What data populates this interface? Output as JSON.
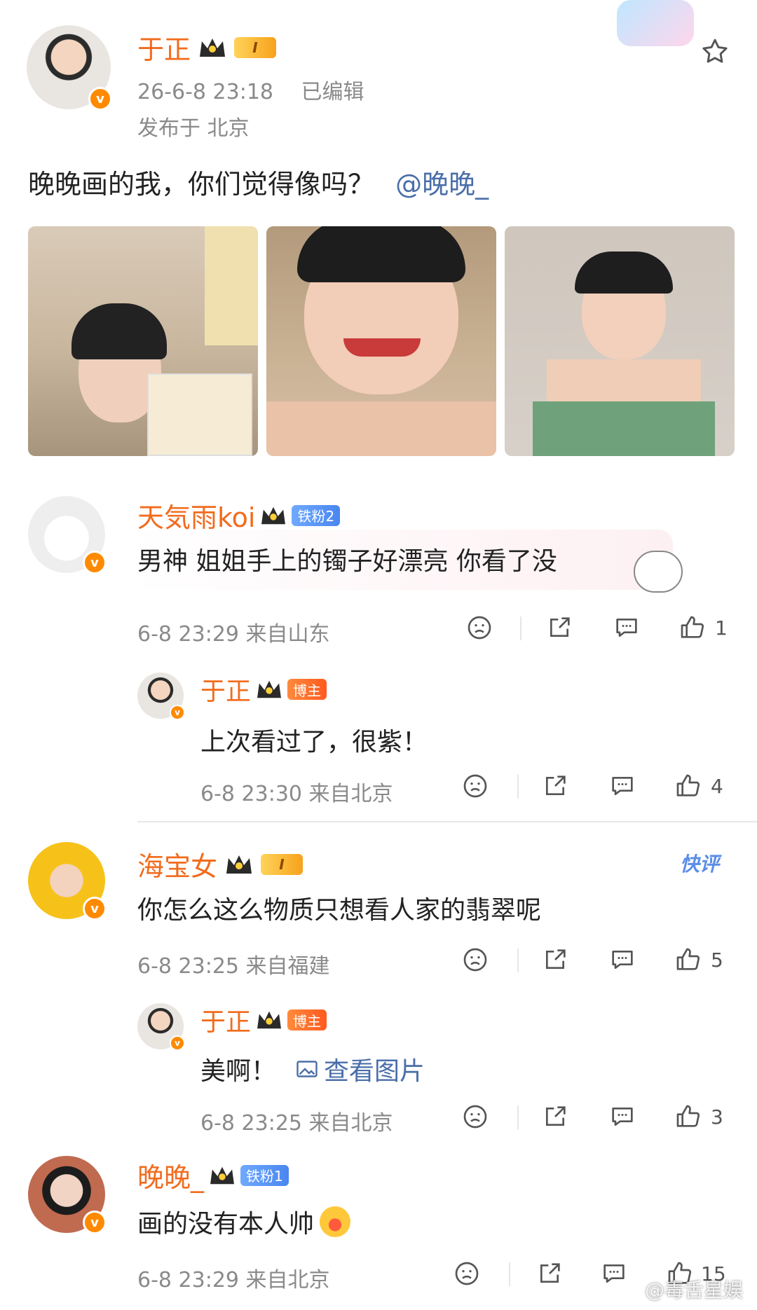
{
  "post": {
    "author": "于正",
    "timestamp": "26-6-8 23:18",
    "edited": "已编辑",
    "location": "发布于 北京",
    "text": "晚晚画的我，你们觉得像吗？",
    "mention": "@晚晚_"
  },
  "badges": {
    "level_i": "I",
    "iron_fan_2": "铁粉2",
    "iron_fan_1": "铁粉1",
    "blogger": "博主",
    "quick_review": "快评"
  },
  "comments": [
    {
      "user": "天気雨koi",
      "text": "男神 姐姐手上的镯子好漂亮 你看了没",
      "meta": "6-8 23:29 来自山东",
      "likes": "1",
      "reply": {
        "user": "于正",
        "text": "上次看过了，很紫！",
        "meta": "6-8 23:30 来自北京",
        "likes": "4"
      }
    },
    {
      "user": "海宝女",
      "text": "你怎么这么物质只想看人家的翡翠呢",
      "meta": "6-8 23:25 来自福建",
      "likes": "5",
      "reply": {
        "user": "于正",
        "text": "美啊！",
        "view_image": "查看图片",
        "meta": "6-8 23:25 来自北京",
        "likes": "3"
      }
    },
    {
      "user": "晚晚_",
      "text": "画的没有本人帅",
      "meta": "6-8 23:29 来自北京",
      "likes": "15"
    }
  ],
  "watermark": "@毒舌星娱",
  "icons": [
    "star-icon",
    "dislike-icon",
    "share-icon",
    "comment-icon",
    "like-icon",
    "image-icon",
    "verified-icon",
    "crown-icon"
  ],
  "colors": {
    "username": "#f26b1d",
    "mention": "#4a6ea9",
    "meta": "#8a8a8a",
    "verified": "#ff8a00"
  }
}
